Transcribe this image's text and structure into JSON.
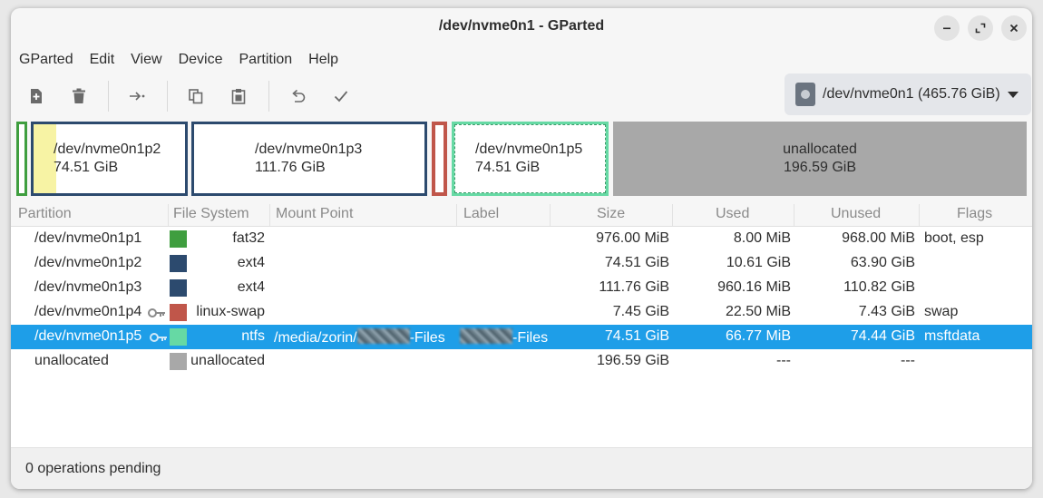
{
  "window": {
    "title": "/dev/nvme0n1 - GParted"
  },
  "menu": [
    "GParted",
    "Edit",
    "View",
    "Device",
    "Partition",
    "Help"
  ],
  "toolbar": {
    "buttons": [
      "new-icon",
      "delete-icon",
      "resize-move-icon",
      "copy-icon",
      "paste-icon",
      "undo-icon",
      "apply-icon"
    ]
  },
  "device": {
    "label": "/dev/nvme0n1 (465.76 GiB)"
  },
  "diskmap": [
    {
      "name": "/dev/nvme0n1p2",
      "size": "74.51 GiB"
    },
    {
      "name": "/dev/nvme0n1p3",
      "size": "111.76 GiB"
    },
    {
      "name": "/dev/nvme0n1p5",
      "size": "74.51 GiB"
    },
    {
      "name": "unallocated",
      "size": "196.59 GiB"
    }
  ],
  "columns": [
    "Partition",
    "File System",
    "Mount Point",
    "Label",
    "Size",
    "Used",
    "Unused",
    "Flags"
  ],
  "rows": [
    {
      "partition": "/dev/nvme0n1p1",
      "fs": "fat32",
      "mount_prefix": "",
      "mount_suffix": "",
      "label_suffix": "",
      "size": "976.00 MiB",
      "used": "8.00 MiB",
      "unused": "968.00 MiB",
      "flags": "boot, esp"
    },
    {
      "partition": "/dev/nvme0n1p2",
      "fs": "ext4",
      "mount_prefix": "",
      "mount_suffix": "",
      "label_suffix": "",
      "size": "74.51 GiB",
      "used": "10.61 GiB",
      "unused": "63.90 GiB",
      "flags": ""
    },
    {
      "partition": "/dev/nvme0n1p3",
      "fs": "ext4",
      "mount_prefix": "",
      "mount_suffix": "",
      "label_suffix": "",
      "size": "111.76 GiB",
      "used": "960.16 MiB",
      "unused": "110.82 GiB",
      "flags": ""
    },
    {
      "partition": "/dev/nvme0n1p4",
      "fs": "linux-swap",
      "mount_prefix": "",
      "mount_suffix": "",
      "label_suffix": "",
      "size": "7.45 GiB",
      "used": "22.50 MiB",
      "unused": "7.43 GiB",
      "flags": "swap"
    },
    {
      "partition": "/dev/nvme0n1p5",
      "fs": "ntfs",
      "mount_prefix": "/media/zorin/",
      "mount_suffix": "-Files",
      "label_suffix": "-Files",
      "size": "74.51 GiB",
      "used": "66.77 MiB",
      "unused": "74.44 GiB",
      "flags": "msftdata"
    },
    {
      "partition": "unallocated",
      "fs": "unallocated",
      "mount_prefix": "",
      "mount_suffix": "",
      "label_suffix": "",
      "size": "196.59 GiB",
      "used": "---",
      "unused": "---",
      "flags": ""
    }
  ],
  "colors": {
    "fat32": "#3f9e3f",
    "ext4": "#2c4a6e",
    "linux-swap": "#c0564a",
    "ntfs": "#66d9a4",
    "unallocated": "#a8a8a8",
    "selection": "#1e9ee8"
  },
  "status": {
    "text": "0 operations pending"
  }
}
